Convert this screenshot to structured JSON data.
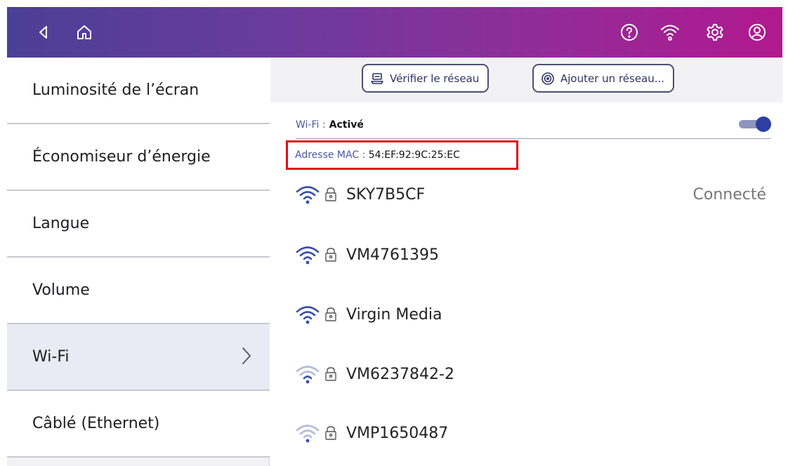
{
  "topbar": {
    "icons": [
      "back-icon",
      "home-icon",
      "help-icon",
      "wifi-icon",
      "settings-icon",
      "account-icon"
    ],
    "gradient": [
      "#4b3f96",
      "#b1198e"
    ]
  },
  "sidebar": {
    "items": [
      {
        "label": "Luminosité de l’écran"
      },
      {
        "label": "Économiseur d’énergie"
      },
      {
        "label": "Langue"
      },
      {
        "label": "Volume"
      },
      {
        "label": "Wi-Fi",
        "active": true
      },
      {
        "label": "Câblé (Ethernet)"
      }
    ]
  },
  "toolbar": {
    "check_network_label": "Vérifier le réseau",
    "add_network_label": "Ajouter un réseau..."
  },
  "wifi": {
    "label": "Wi-Fi :",
    "state": "Activé",
    "enabled": true
  },
  "mac": {
    "label": "Adresse MAC :",
    "value": "54:EF:92:9C:25:EC",
    "highlight_color": "#e50914"
  },
  "networks": [
    {
      "ssid": "SKY7B5CF",
      "status": "Connecté",
      "signal": 4,
      "locked": true
    },
    {
      "ssid": "VM4761395",
      "status": "",
      "signal": 4,
      "locked": true
    },
    {
      "ssid": "Virgin Media",
      "status": "",
      "signal": 4,
      "locked": true
    },
    {
      "ssid": "VM6237842-2",
      "status": "",
      "signal": 2,
      "locked": true
    },
    {
      "ssid": "VMP1650487",
      "status": "",
      "signal": 1,
      "locked": true
    }
  ],
  "colors": {
    "accent": "#2d3fa0",
    "label_blue": "#4a57a0",
    "signal_strong": "#3b4fa8",
    "signal_weak": "#b3badb"
  }
}
